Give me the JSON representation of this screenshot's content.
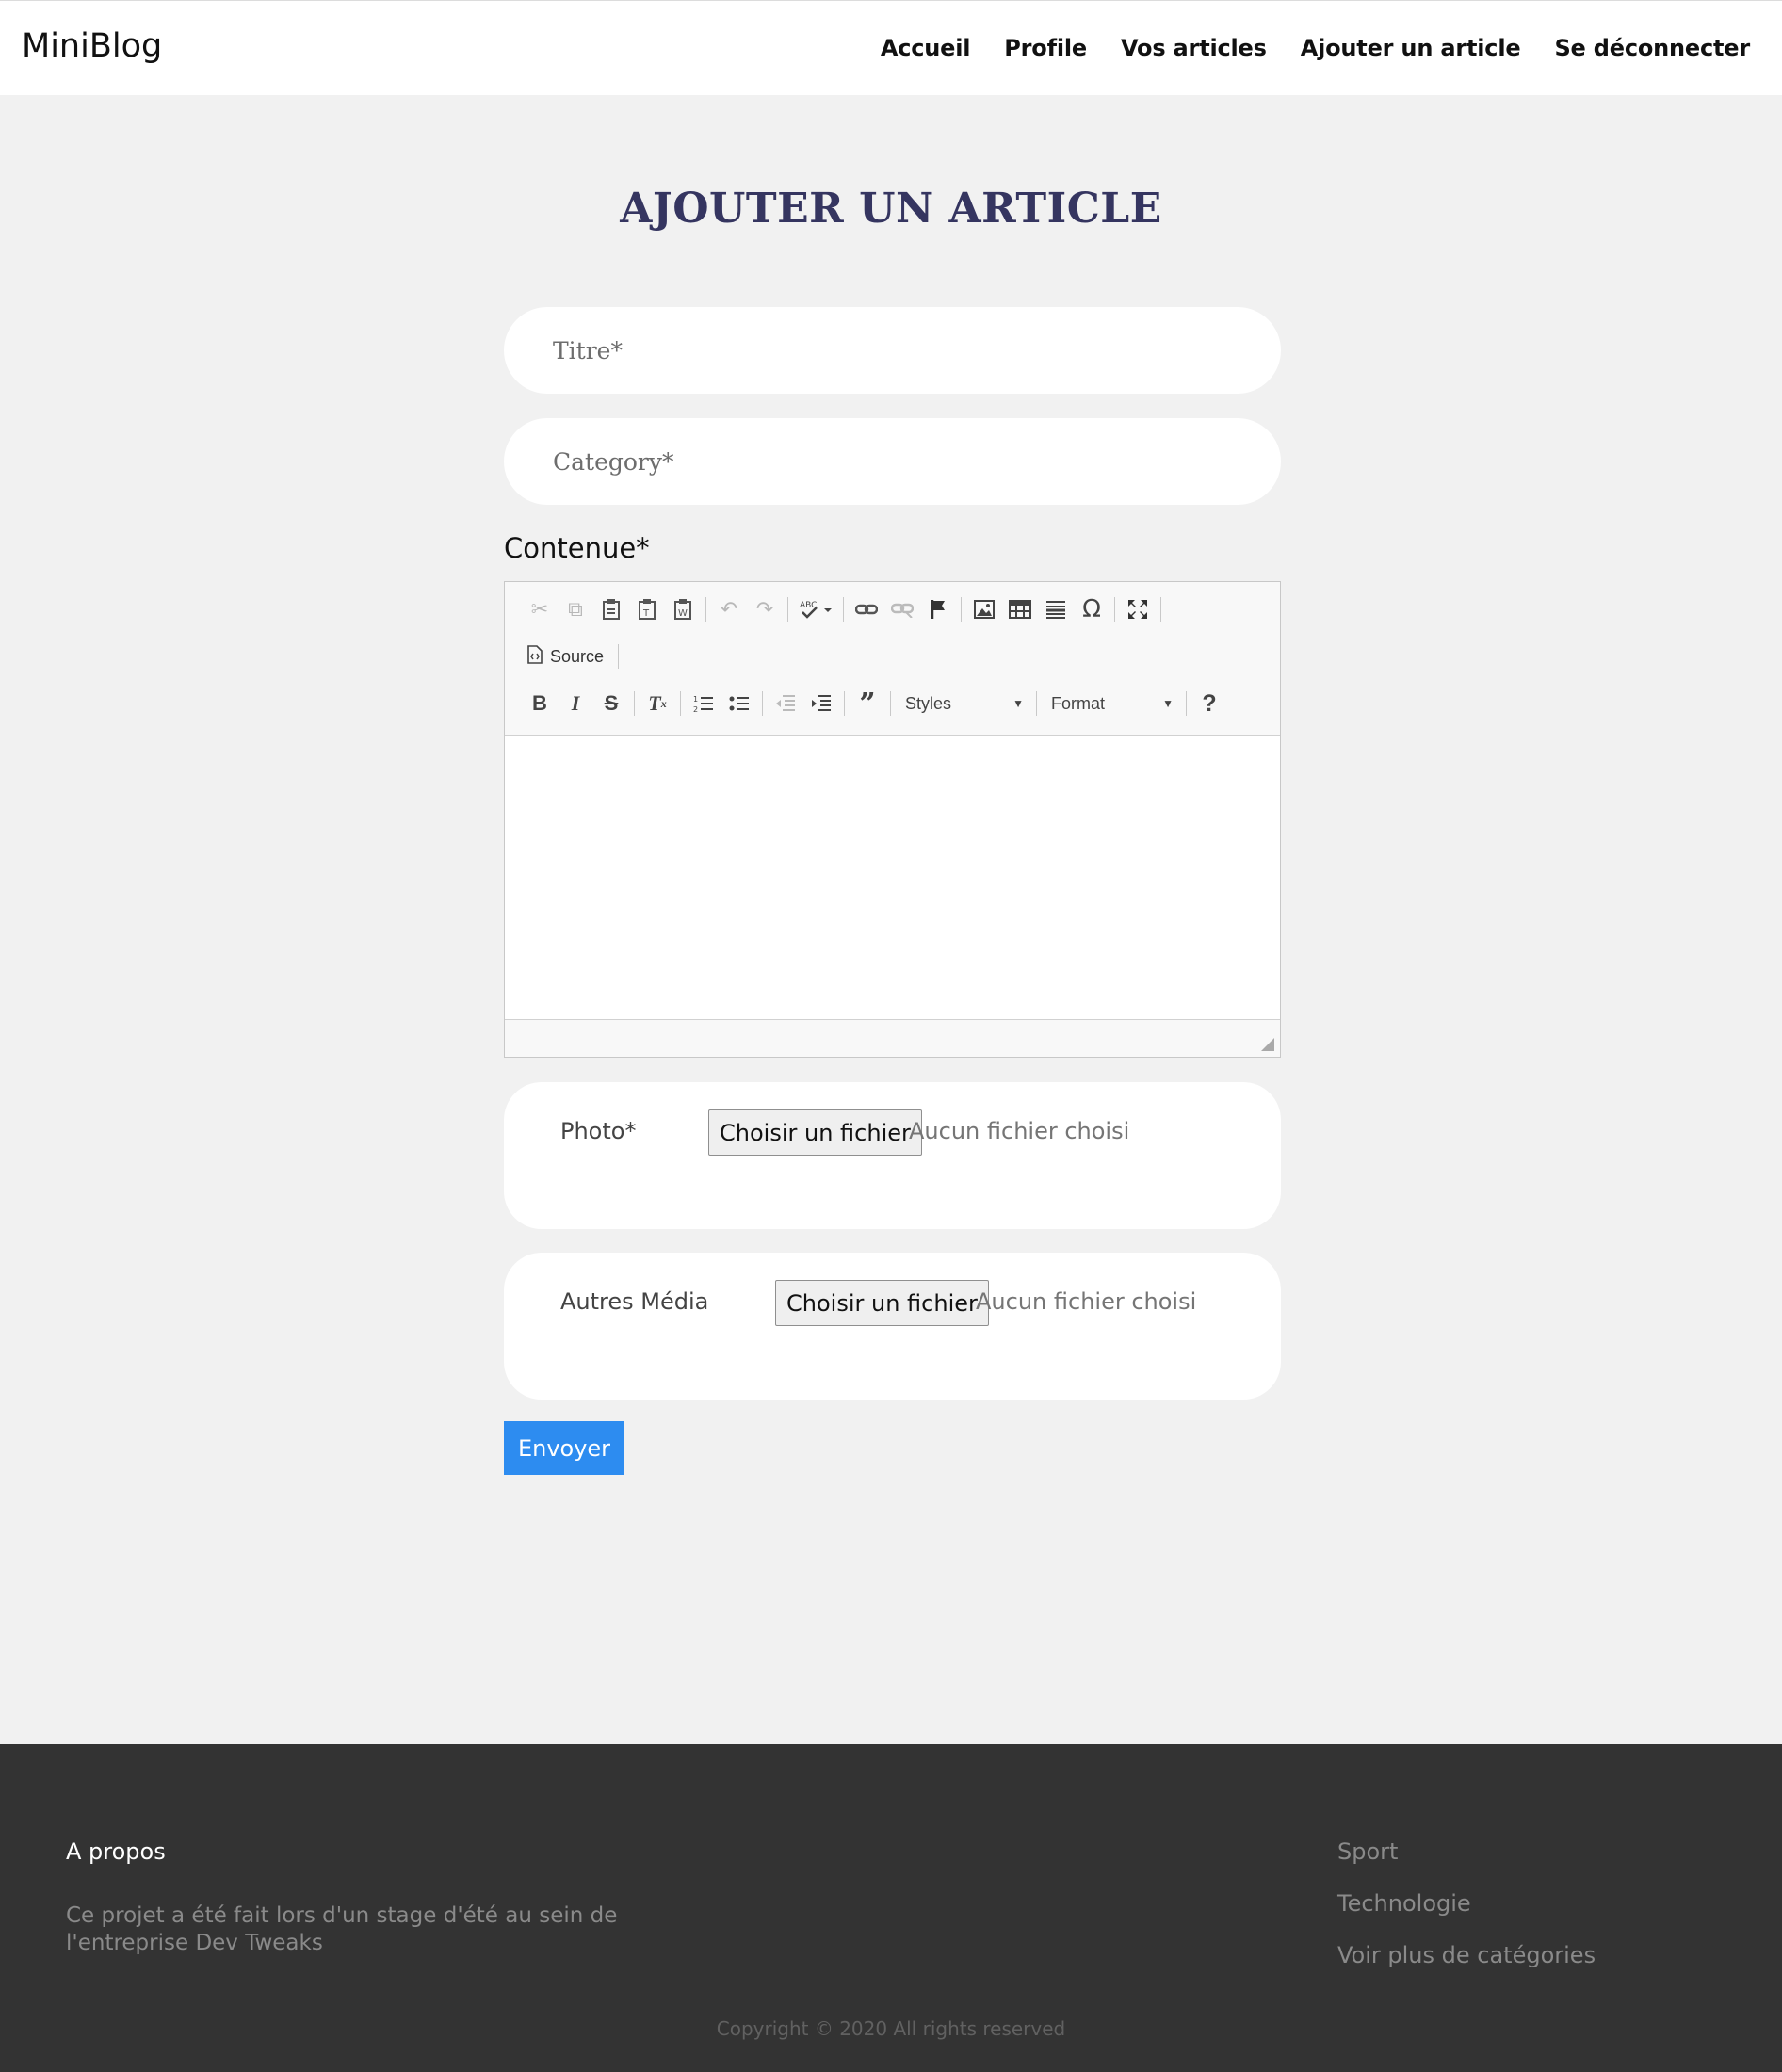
{
  "header": {
    "brand": "MiniBlog",
    "nav": [
      "Accueil",
      "Profile",
      "Vos articles",
      "Ajouter un article",
      "Se déconnecter"
    ]
  },
  "main": {
    "title": "AJOUTER UN ARTICLE",
    "titre_placeholder": "Titre*",
    "category_placeholder": "Category*",
    "contenu_label": "Contenue*"
  },
  "editor": {
    "row1_icons": [
      "cut-icon",
      "copy-icon",
      "paste-icon",
      "paste-text-icon",
      "paste-word-icon",
      "undo-icon",
      "redo-icon",
      "spellcheck-icon",
      "link-icon",
      "unlink-icon",
      "anchor-icon",
      "image-icon",
      "table-icon",
      "horizontal-rule-icon",
      "special-char-icon",
      "maximize-icon"
    ],
    "source_label": "Source",
    "row3_icons": [
      "bold-icon",
      "italic-icon",
      "strikethrough-icon",
      "remove-format-icon",
      "numbered-list-icon",
      "bulleted-list-icon",
      "outdent-icon",
      "indent-icon",
      "blockquote-icon",
      "help-icon"
    ],
    "styles_label": "Styles",
    "format_label": "Format"
  },
  "photo": {
    "label": "Photo*",
    "button": "Choisir un fichier",
    "status": "Aucun fichier choisi"
  },
  "media": {
    "label": "Autres Média",
    "button": "Choisir un fichier",
    "status": "Aucun fichier choisi"
  },
  "submit_label": "Envoyer",
  "footer": {
    "about_title": "A propos",
    "about_text": "Ce projet a été fait lors d'un stage d'été au sein de l'entreprise Dev Tweaks",
    "links": [
      "Sport",
      "Technologie",
      "Voir plus de catégories"
    ],
    "copyright": "Copyright © 2020 All rights reserved"
  },
  "colors": {
    "title": "#353560",
    "submit": "#2d8cf0",
    "footer_bg": "#333333",
    "page_bg": "#f1f1f1"
  }
}
